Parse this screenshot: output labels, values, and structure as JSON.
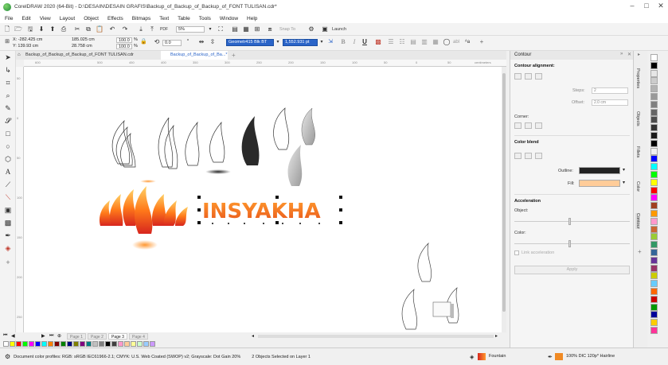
{
  "window": {
    "title": "CorelDRAW 2020 (64-Bit) - D:\\DESAIN\\DESAIN GRAFIS\\Backup_of_Backup_of_Backup_of_FONT TULISAN.cdr*",
    "controls": [
      "–",
      "□",
      "✕"
    ]
  },
  "menu": [
    "File",
    "Edit",
    "View",
    "Layout",
    "Object",
    "Effects",
    "Bitmaps",
    "Text",
    "Table",
    "Tools",
    "Window",
    "Help"
  ],
  "toolbar1": {
    "zoom": "5%",
    "launch": "Launch",
    "snap_to": "Snap To"
  },
  "toolbar2": {
    "x": "X: -282.425 cm",
    "y": "Y: 139.93 cm",
    "w": "185.025 cm",
    "h": "28.758 cm",
    "scale_x": "100.0",
    "scale_y": "100.0",
    "pct": "%",
    "angle": "0.0",
    "font_name": "Geometr415 Blk BT",
    "font_size": "1,552.931 pt"
  },
  "tabs": {
    "doc1": "Backup_of_Backup_of_Backup_of_FONT TULISAN.cdr",
    "doc2": "Backup_of_Backup_of_Ba...*",
    "add": "+"
  },
  "ruler": {
    "unit": "centimeters",
    "h_ticks": [
      "600",
      "500",
      "450",
      "400",
      "350",
      "300",
      "250",
      "200",
      "150",
      "100",
      "50",
      "0",
      "50"
    ],
    "v_ticks": [
      "50",
      "0",
      "50",
      "100",
      "150",
      "200",
      "250"
    ]
  },
  "canvas": {
    "brand_text": "INSYAKHA"
  },
  "pages": [
    "Page 1",
    "Page 2",
    "Page 3",
    "Page 4"
  ],
  "palette_row": [
    "#ffffff",
    "#ffff00",
    "#ff0000",
    "#00ff00",
    "#ff00ff",
    "#0000ff",
    "#00ffff",
    "#ff8000",
    "#800000",
    "#008000",
    "#000080",
    "#808000",
    "#800080",
    "#008080",
    "#c0c0c0",
    "#808080",
    "#000000",
    "#404040",
    "#ff99cc",
    "#ffcc99",
    "#ffff99",
    "#ccffcc",
    "#99ccff",
    "#cc99ff"
  ],
  "status": {
    "profile": "Document color profiles: RGB: sRGB IEC61966-2.1; CMYK: U.S. Web Coated (SWOP) v2; Grayscale: Dot Gain 20%",
    "selection": "2 Objects Selected on Layer 1",
    "fill_label": "Fountain",
    "outline_label": "100% DIC 120p*  Hairline"
  },
  "docker": {
    "title": "Contour",
    "alignment_label": "Contour alignment:",
    "steps_label": "Steps:",
    "steps_value": "2",
    "offset_label": "Offset:",
    "offset_value": "2.0 cm",
    "corner_label": "Corner:",
    "color_blend_label": "Color blend",
    "outline_label": "Outline:",
    "fill_label": "Fill:",
    "acceleration_label": "Acceleration",
    "object_label": "Object:",
    "color_label": "Color:",
    "link_label": "Link acceleration",
    "apply_label": "Apply",
    "outline_color": "#222222",
    "fill_color": "#ffcc99"
  },
  "side_tabs": [
    "Properties",
    "Objects",
    "Fillets",
    "Color",
    "Contour"
  ],
  "vertical_palette": [
    "#ffffff",
    "#000000",
    "#e6e6e6",
    "#cccccc",
    "#b3b3b3",
    "#999999",
    "#808080",
    "#666666",
    "#4d4d4d",
    "#333333",
    "#1a1a1a",
    "#000000",
    "#f0f0f0",
    "#0000ff",
    "#00ffff",
    "#00ff00",
    "#ffff00",
    "#ff0000",
    "#ff00ff",
    "#a04020",
    "#ff9900",
    "#ff99cc",
    "#cc6633",
    "#99cc33",
    "#339966",
    "#336699",
    "#663399",
    "#993366",
    "#cccc00",
    "#66ccff",
    "#ff6600",
    "#cc0000",
    "#009900",
    "#000099",
    "#ffcc00",
    "#ff3399"
  ]
}
